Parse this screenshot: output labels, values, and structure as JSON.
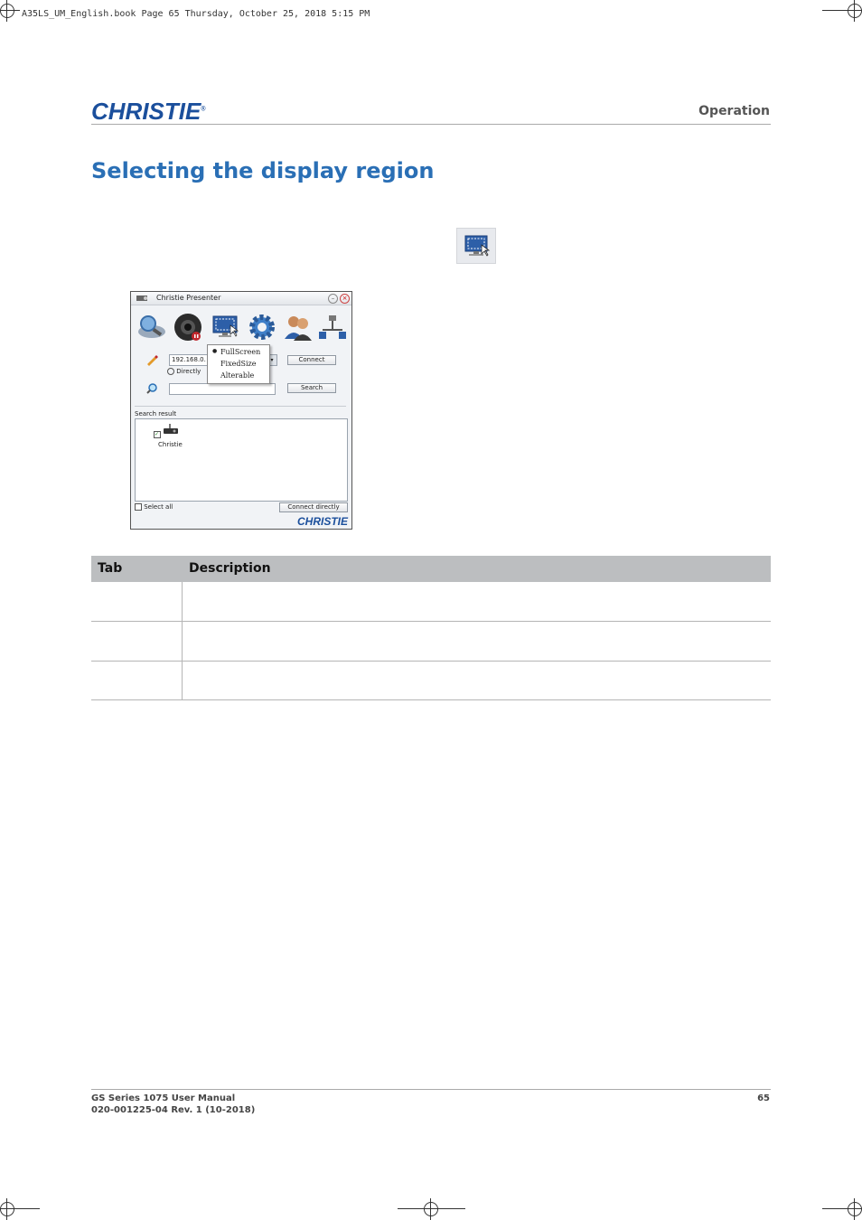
{
  "crop_header": "A35LS_UM_English.book  Page 65  Thursday, October 25, 2018  5:15 PM",
  "header": {
    "logo_text": "CHRISTIE",
    "logo_mark": "®",
    "section": "Operation"
  },
  "title": "Selecting the display region",
  "inline_icon": "select-region-icon",
  "app": {
    "window_title": "Christie Presenter",
    "toolbar_icons": [
      "projector-search-icon",
      "camera-record-icon",
      "display-region-icon",
      "settings-gear-icon",
      "users-icon",
      "network-share-icon"
    ],
    "ip_value": "192.168.0.",
    "directly_label": "Directly",
    "connect_button": "Connect",
    "search_button": "Search",
    "search_value": "",
    "menu": {
      "items": [
        "FullScreen",
        "FixedSize",
        "Alterable"
      ],
      "selected": "FullScreen"
    },
    "search_result_label": "Search result",
    "result_device_name": "Christie",
    "select_all_label": "Select all",
    "connect_directly_button": "Connect directly",
    "footer_logo": "CHRISTIE"
  },
  "table": {
    "headers": [
      "Tab",
      "Description"
    ],
    "rows": [
      [
        "",
        ""
      ],
      [
        "",
        ""
      ],
      [
        "",
        ""
      ]
    ]
  },
  "footer": {
    "manual": "GS Series 1075 User Manual",
    "doc_number": "020-001225-04 Rev. 1 (10-2018)",
    "page": "65"
  },
  "colors": {
    "brand_blue": "#1b4f9c",
    "title_blue": "#2a6fb5",
    "table_header": "#bcbec0"
  }
}
